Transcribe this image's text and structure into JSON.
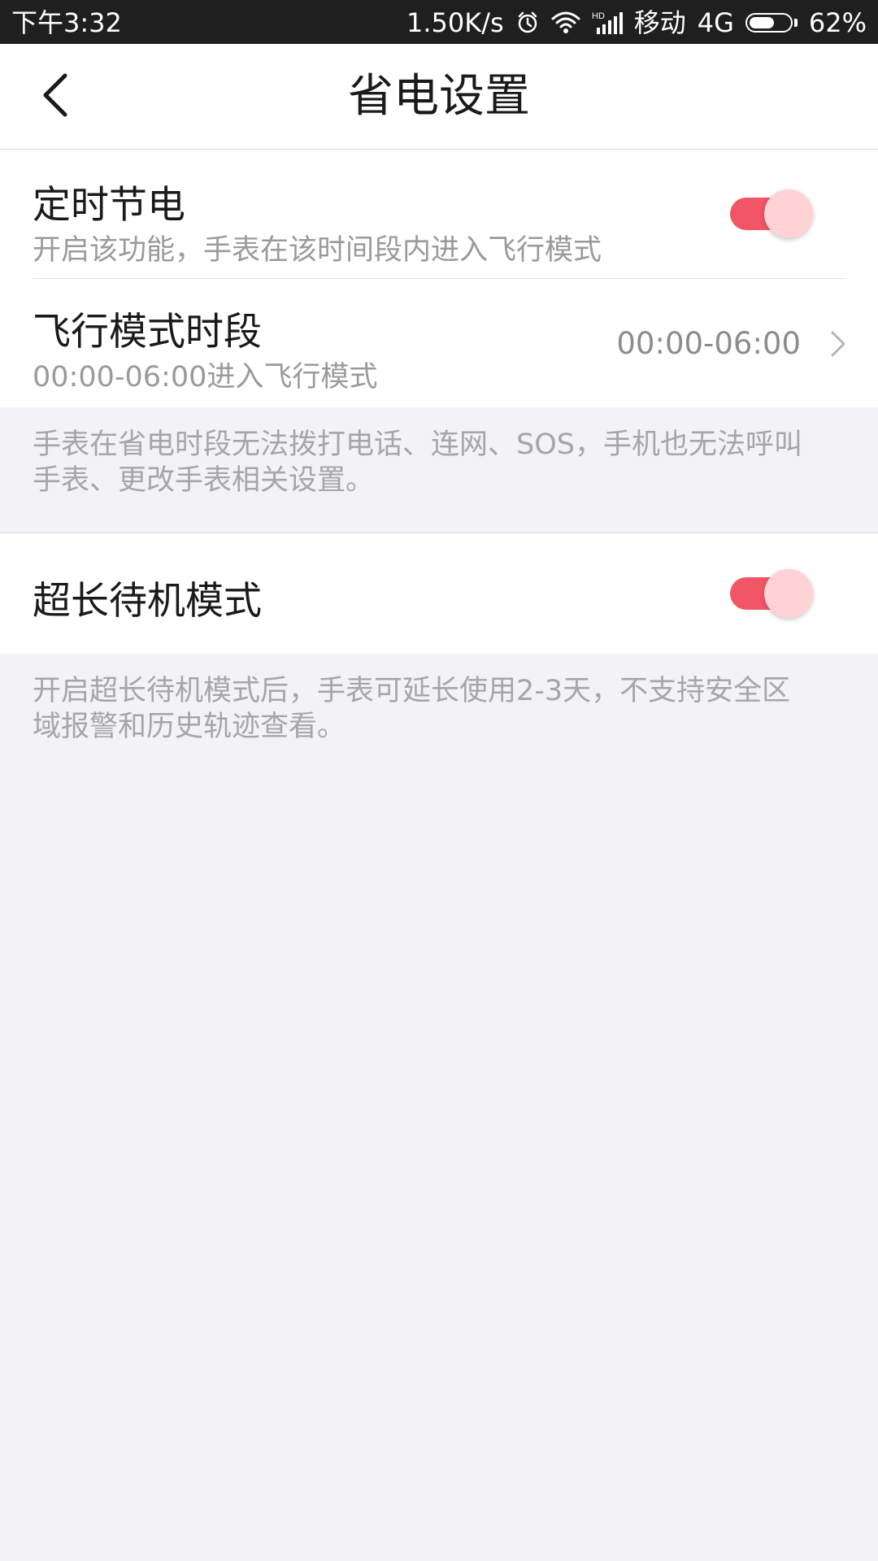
{
  "status_bar": {
    "time": "下午3:32",
    "net_speed": "1.50K/s",
    "alarm_icon": "alarm-clock-icon",
    "wifi_icon": "wifi-icon",
    "signal_hd_label": "HD",
    "carrier": "移动",
    "network_type": "4G",
    "battery_percent_text": "62%",
    "battery_level": 0.62
  },
  "header": {
    "back_icon": "chevron-left-icon",
    "title": "省电设置"
  },
  "timed_power_saving": {
    "title": "定时节电",
    "subtitle": "开启该功能，手表在该时间段内进入飞行模式",
    "enabled": true
  },
  "airplane_period": {
    "title": "飞行模式时段",
    "subtitle": "00:00-06:00进入飞行模式",
    "value": "00:00-06:00",
    "chevron_icon": "chevron-right-icon"
  },
  "power_saving_note": {
    "line1": "手表在省电时段无法拨打电话、连网、SOS，手机也无法呼叫",
    "line2": "手表、更改手表相关设置。"
  },
  "ultra_standby": {
    "title": "超长待机模式",
    "enabled": true
  },
  "ultra_standby_note": {
    "line1": "开启超长待机模式后，手表可延长使用2-3天，不支持安全区",
    "line2": "域报警和历史轨迹查看。"
  },
  "colors": {
    "accent_toggle_track": "#f25565",
    "toggle_knob": "#ffd2d6",
    "status_bar_bg": "#1f1f1f",
    "page_bg": "#f2f2f7"
  }
}
